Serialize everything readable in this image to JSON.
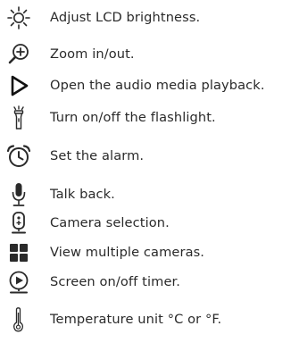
{
  "items": [
    {
      "icon": "brightness-icon",
      "label": "Adjust LCD brightness."
    },
    {
      "icon": "zoom-in-icon",
      "label": "Zoom in/out."
    },
    {
      "icon": "play-icon",
      "label": "Open the audio media playback."
    },
    {
      "icon": "flashlight-icon",
      "label": "Turn on/off the flashlight."
    },
    {
      "icon": "alarm-clock-icon",
      "label": "Set the alarm."
    },
    {
      "icon": "microphone-icon",
      "label": "Talk back."
    },
    {
      "icon": "camera-select-icon",
      "label": "Camera selection."
    },
    {
      "icon": "multi-camera-grid-icon",
      "label": "View multiple cameras."
    },
    {
      "icon": "screen-timer-icon",
      "label": "Screen on/off timer."
    },
    {
      "icon": "thermometer-icon",
      "label": "Temperature unit °C or °F."
    }
  ],
  "colors": {
    "icon": "#2a2a2a",
    "text": "#2a2a2a"
  }
}
